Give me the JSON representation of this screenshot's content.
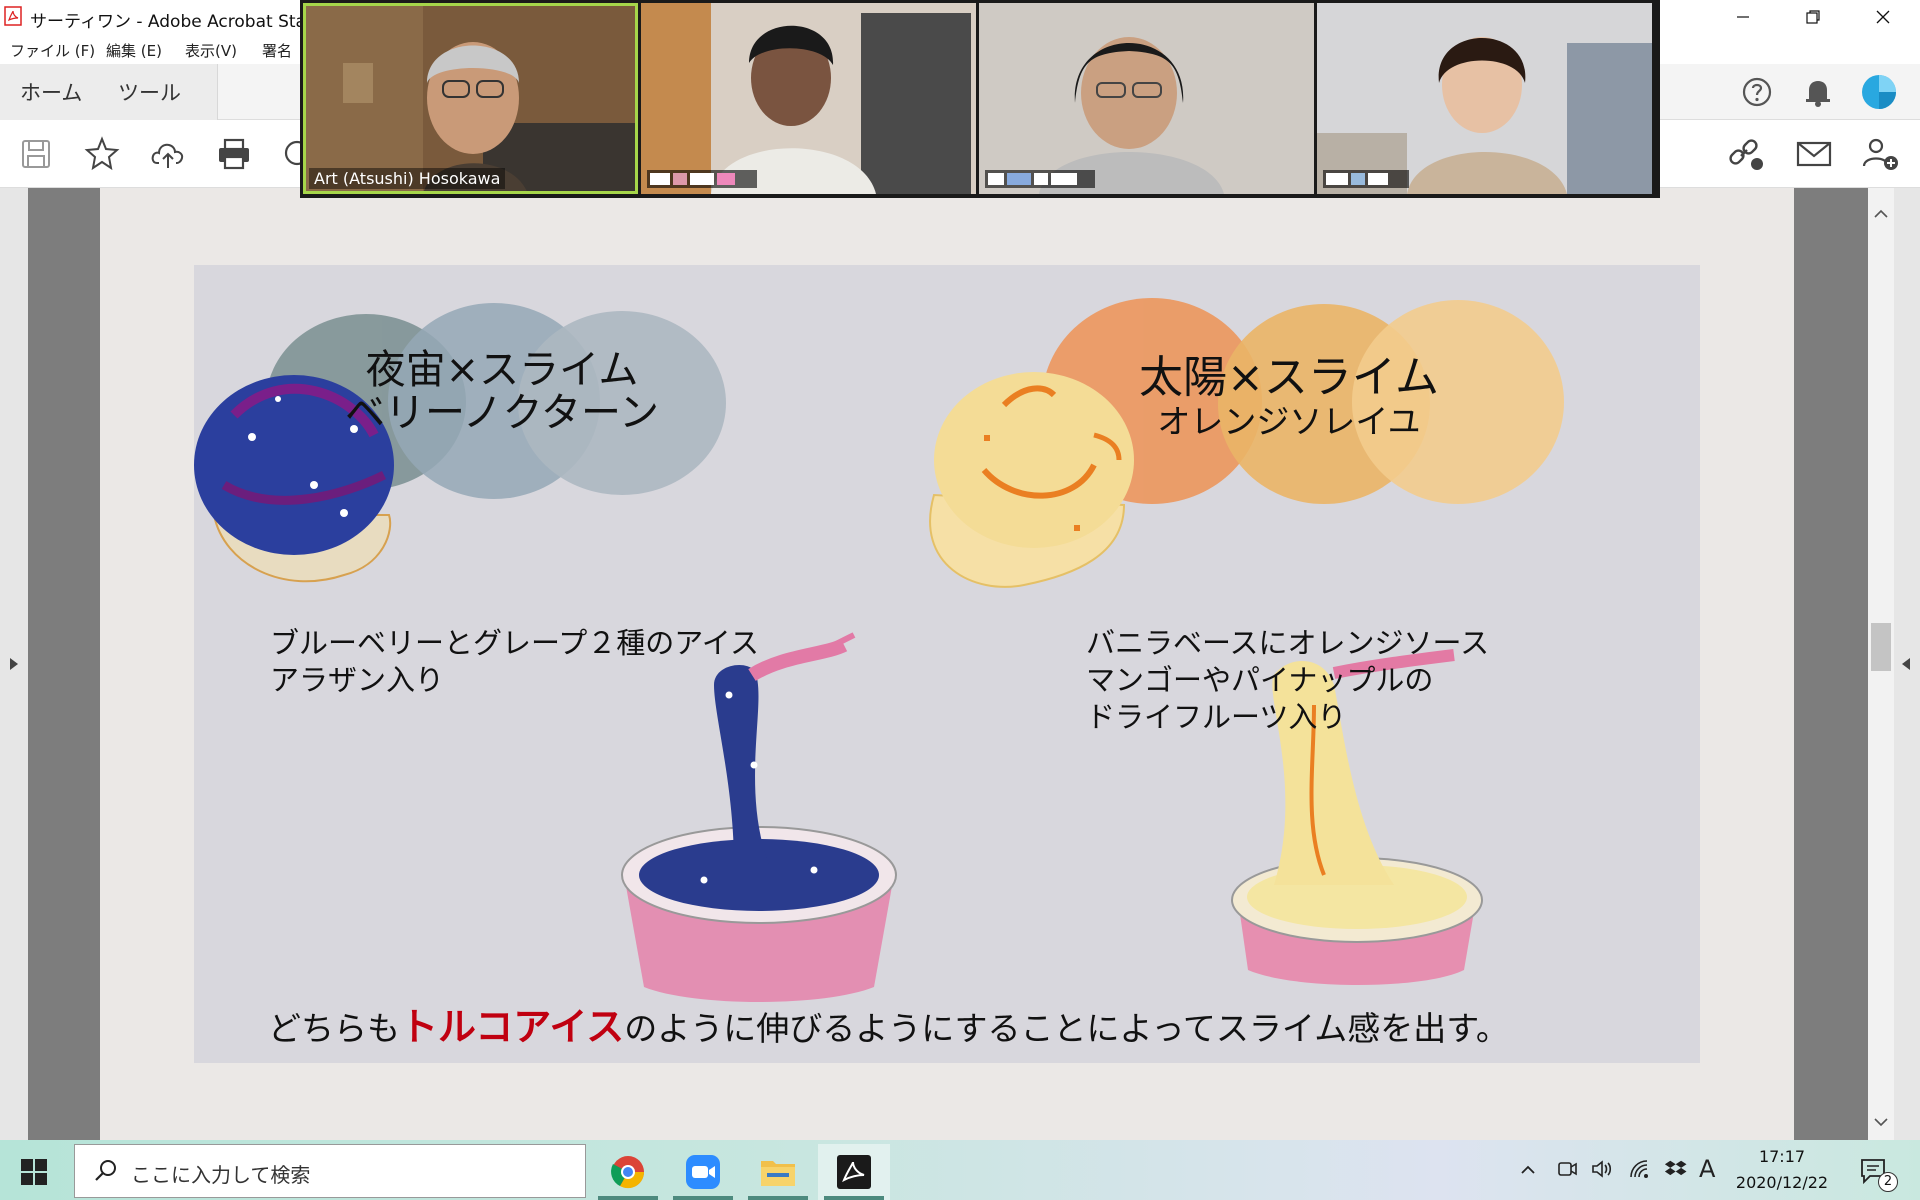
{
  "window": {
    "title": "サーティワン - Adobe Acrobat Stan",
    "controls": [
      "minimize",
      "restore",
      "close"
    ]
  },
  "menu": {
    "items": [
      "ファイル (F)",
      "編集 (E)",
      "表示(V)",
      "署名"
    ]
  },
  "tabs": {
    "home": "ホーム",
    "tools": "ツール"
  },
  "toolbar": {
    "left_icons": [
      "save-icon",
      "star-icon",
      "cloud-upload-icon",
      "print-icon",
      "zoom-icon"
    ],
    "right_icons": [
      "help-icon",
      "bell-icon",
      "profile-icon"
    ],
    "share_icons": [
      "link-icon",
      "mail-icon",
      "add-user-icon"
    ]
  },
  "slide": {
    "left": {
      "title_line1": "夜宙×スライム",
      "title_line2": "ベリーノクターン",
      "desc_line1": "ブルーベリーとグレープ２種のアイス",
      "desc_line2": "アラザン入り"
    },
    "right": {
      "title_line1": "太陽×スライム",
      "title_line2": "オレンジソレイユ",
      "desc_line1": "バニラベースにオレンジソース",
      "desc_line2": "マンゴーやパイナップルの",
      "desc_line3": "ドライフルーツ入り"
    },
    "bottom": {
      "before": "どちらも",
      "highlight": "トルコアイス",
      "after": "のように伸びるようにすることによってスライム感を出す。"
    },
    "colors": {
      "night_circles": [
        "#7f9395",
        "#8ea3b3",
        "#a9b5bf"
      ],
      "sun_circles": [
        "#ec9a63",
        "#ecb460",
        "#f5cc8a"
      ],
      "highlight": "#c00010"
    }
  },
  "video": {
    "participants": [
      {
        "name": "Art (Atsushi) Hosokawa",
        "active": true
      },
      {
        "name": "",
        "active": false
      },
      {
        "name": "",
        "active": false
      },
      {
        "name": "",
        "active": false
      }
    ]
  },
  "taskbar": {
    "search_placeholder": "ここに入力して検索",
    "apps": [
      "chrome-icon",
      "zoom-app-icon",
      "file-explorer-icon",
      "acrobat-icon"
    ],
    "ime": "A",
    "time": "17:17",
    "date": "2020/12/22",
    "notification_count": "2"
  }
}
